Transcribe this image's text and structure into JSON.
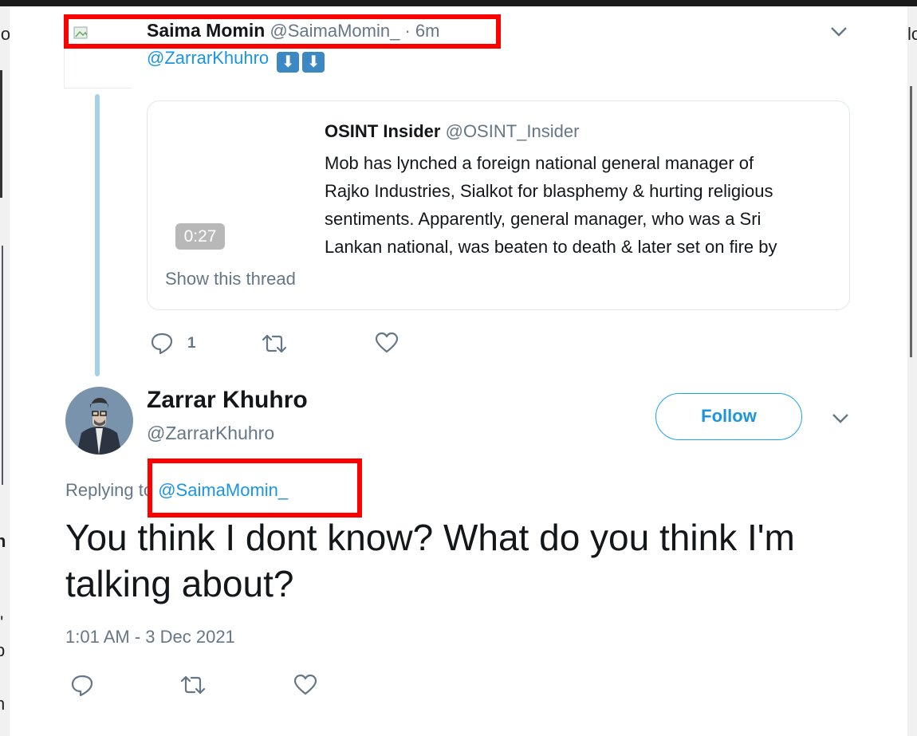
{
  "top_tweet": {
    "author_name": "Saima Momin",
    "author_handle": "@SaimaMomin_",
    "separator": "·",
    "time": "6m",
    "mention": "@ZarrarKhuhro",
    "emoji": [
      "⬇",
      "⬇"
    ],
    "actions": {
      "reply_count": "1"
    }
  },
  "quoted_tweet": {
    "author_name": "OSINT Insider",
    "author_handle": "@OSINT_Insider",
    "video_duration": "0:27",
    "show_thread": "Show this thread",
    "text_lines": [
      "Mob has lynched a foreign national general manager of",
      "Rajko Industries, Sialkot for blasphemy & hurting religious",
      "sentiments. Apparently, general manager, who  was a Sri",
      "Lankan national, was beaten to death & later set on fire by"
    ]
  },
  "main_tweet": {
    "author_name": "Zarrar Khuhro",
    "author_handle": "@ZarrarKhuhro",
    "follow_label": "Follow",
    "replying_prefix": "Replying to",
    "replying_handle": "@SaimaMomin_",
    "text_line1": "You think I dont know? What do you think I'm",
    "text_line2": "talking about?",
    "timestamp": "1:01 AM - 3 Dec 2021"
  },
  "edge_fragments": {
    "top_left": "lo",
    "top_right": "lo",
    "left_1": "h",
    "left_2": "t'",
    "left_3": "p",
    "left_4": "t",
    "left_5": "h"
  },
  "colors": {
    "link": "#1b95e0",
    "muted": "#657786",
    "highlight_box": "#ff0000",
    "thread_line": "#a5d2e7",
    "emoji_bg": "#3b88c3"
  }
}
